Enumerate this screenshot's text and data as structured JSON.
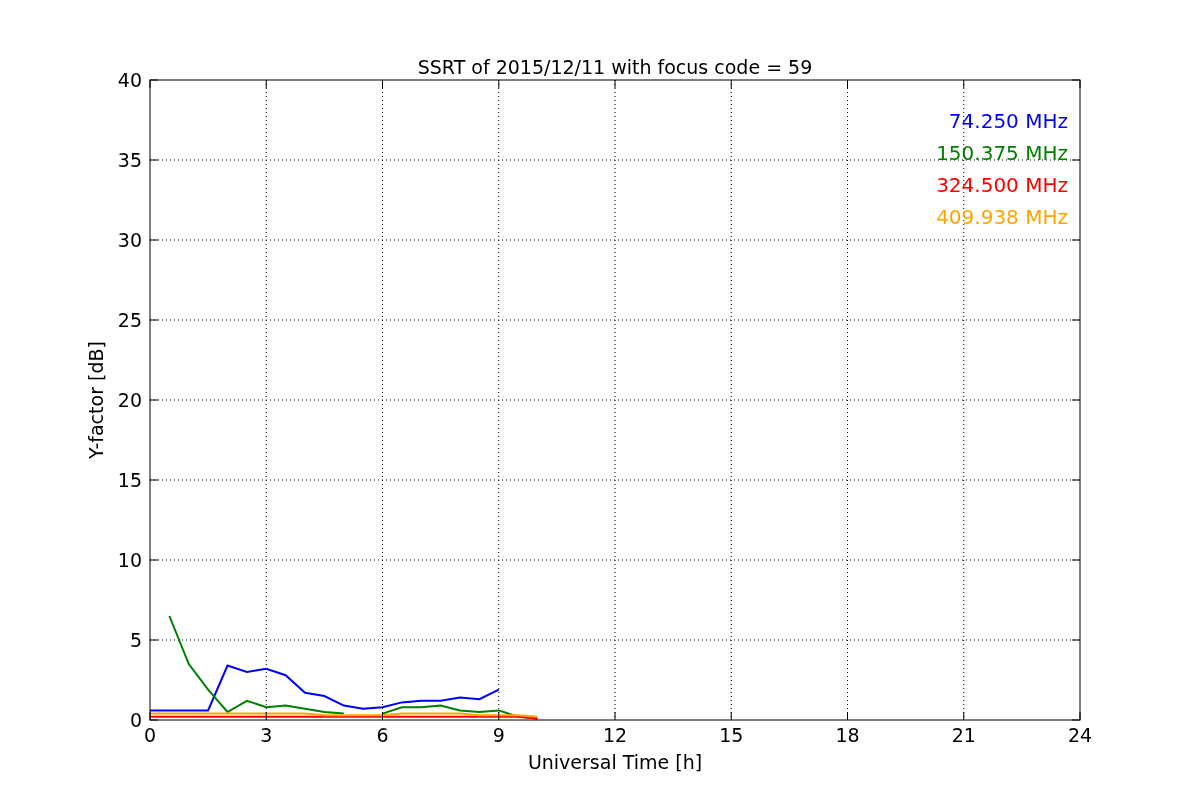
{
  "chart_data": {
    "type": "line",
    "title": "SSRT of 2015/12/11 with focus code = 59",
    "xlabel": "Universal Time [h]",
    "ylabel": "Y-factor [dB]",
    "x": [
      0,
      0.5,
      1,
      1.5,
      2,
      2.5,
      3,
      3.5,
      4,
      4.5,
      5,
      5.5,
      6,
      6.5,
      7,
      7.5,
      8,
      8.5,
      9,
      9.5,
      10
    ],
    "series": [
      {
        "name": "74.250 MHz",
        "color": "#0000ff",
        "values": [
          0.6,
          0.6,
          0.6,
          0.6,
          3.4,
          3.0,
          3.2,
          2.8,
          1.7,
          1.5,
          0.9,
          0.7,
          0.8,
          1.1,
          1.2,
          1.2,
          1.4,
          1.3,
          1.9,
          null,
          null
        ]
      },
      {
        "name": "150.375 MHz",
        "color": "#008000",
        "values": [
          null,
          6.5,
          3.5,
          1.9,
          0.5,
          1.2,
          0.8,
          0.9,
          0.7,
          0.5,
          0.4,
          null,
          0.4,
          0.8,
          0.8,
          0.9,
          0.6,
          0.5,
          0.6,
          0.2,
          0.1
        ]
      },
      {
        "name": "324.500 MHz",
        "color": "#ff0000",
        "values": [
          0.2,
          0.2,
          0.2,
          0.2,
          0.2,
          0.2,
          0.2,
          0.2,
          0.2,
          0.2,
          0.2,
          0.2,
          0.2,
          0.2,
          0.2,
          0.2,
          0.2,
          0.2,
          0.2,
          0.2,
          0.1
        ]
      },
      {
        "name": "409.938 MHz",
        "color": "#ffa500",
        "values": [
          0.4,
          0.4,
          0.4,
          0.4,
          0.4,
          0.4,
          0.4,
          0.4,
          0.4,
          0.3,
          0.3,
          0.3,
          0.3,
          0.4,
          0.4,
          0.4,
          0.4,
          0.3,
          0.3,
          0.3,
          0.2
        ]
      }
    ],
    "grid": true,
    "xlim": [
      0,
      24
    ],
    "ylim": [
      0,
      40
    ],
    "xticks": [
      0,
      3,
      6,
      9,
      12,
      15,
      18,
      21,
      24
    ],
    "yticks": [
      0,
      5,
      10,
      15,
      20,
      25,
      30,
      35,
      40
    ]
  }
}
